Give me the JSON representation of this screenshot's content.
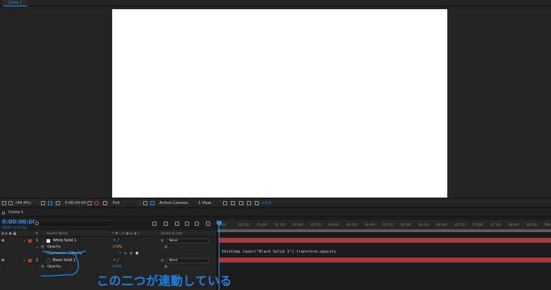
{
  "viewer": {
    "tab_label": "Comp 1"
  },
  "viewer_toolbar": {
    "zoom": "(49.4%)",
    "timecode": "0:00:00:00",
    "resolution": "Full",
    "camera": "Active Camera",
    "view": "1 View",
    "exposure": "+0.0"
  },
  "timeline": {
    "tab_label": "Comp 1",
    "timecode": "0:00:00:00",
    "fps": "00000 (24.00 fps)",
    "search_placeholder": "",
    "columns": {
      "hash": "#",
      "source_name": "Source Name",
      "parent_link": "Parent & Link"
    },
    "ruler_ticks": [
      "00f",
      "00:15f",
      "01:00f",
      "01:15f",
      "02:00f",
      "02:15f",
      "03:00f",
      "03:15f",
      "04:00f",
      "04:15f",
      "05:00f",
      "05:15f",
      "06:00f",
      "06:15f",
      "07:00f",
      "07:15f",
      "08:00f",
      "08:15f",
      "09:00f"
    ],
    "layers": [
      {
        "number": "1",
        "name": "White Solid 1",
        "parent": "None",
        "swatch": "#ffffff",
        "label_color": "#c0392b"
      },
      {
        "number": "2",
        "name": "Black Solid 1",
        "parent": "None",
        "swatch": "#000000",
        "label_color": "#c0392b"
      }
    ],
    "props": {
      "opacity_label": "Opacity",
      "layer1_opacity": "100",
      "percent": "%",
      "expression_label": "Expression: Opacity",
      "layer2_opacity": "100%",
      "expression_text": "thisComp.layer(\"Black Solid 1\").transform.opacity"
    }
  },
  "annotation": {
    "text": "この二つが連動している",
    "color": "#1f7fe0"
  },
  "colors": {
    "accent": "#2f8fe8",
    "layer_bar": "#a73a3a",
    "expression_value": "#e8711e"
  }
}
